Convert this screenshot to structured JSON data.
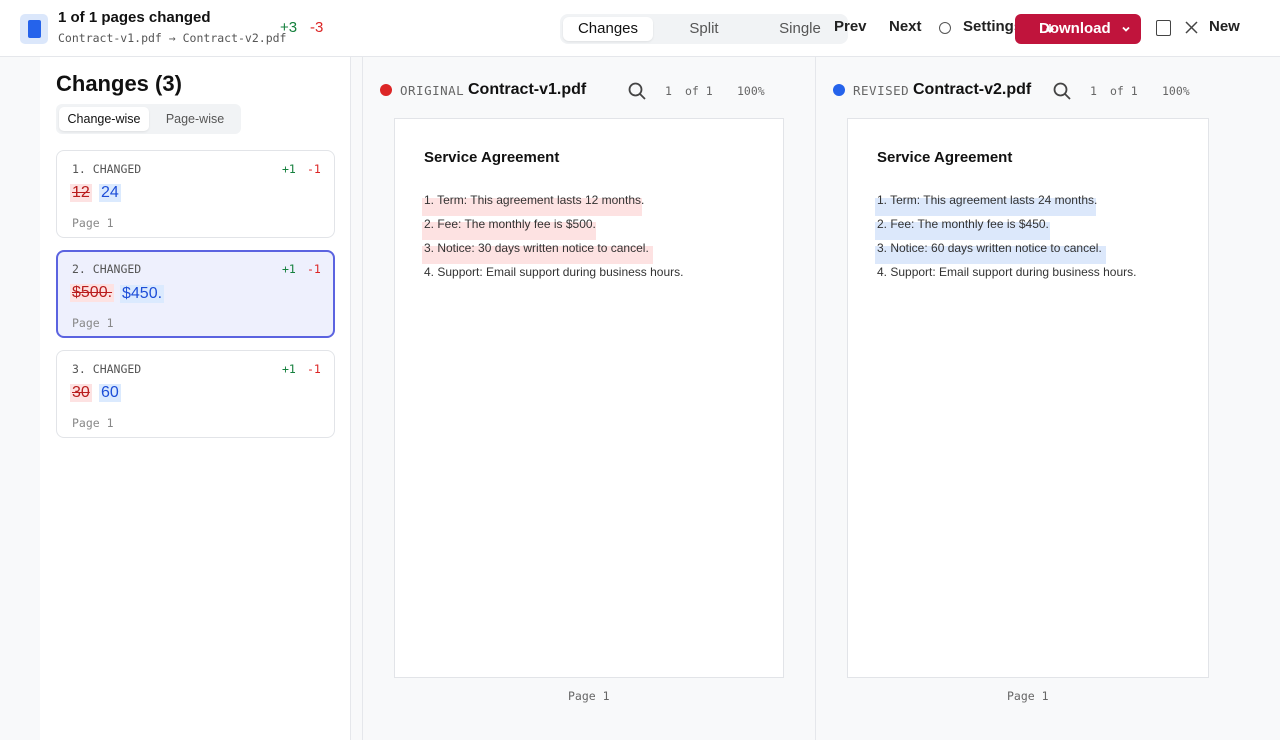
{
  "header": {
    "title": "1 of 1 pages changed",
    "files": "Contract-v1.pdf → Contract-v2.pdf",
    "added": "+3",
    "removed": "-3",
    "view_modes": [
      "Changes",
      "Split",
      "Single"
    ],
    "active_view": "Changes",
    "prev_label": "Prev",
    "next_label": "Next",
    "settings_label": "Settings",
    "download_label": "Download",
    "new_label": "New",
    "accent_color": "#c0143c"
  },
  "sidebar": {
    "title": "Changes (3)",
    "modes": [
      "Change-wise",
      "Page-wise"
    ],
    "active_mode": "Change-wise",
    "changes": [
      {
        "label": "1. CHANGED",
        "plus": "+1",
        "minus": "-1",
        "old": "12",
        "new": "24",
        "page": "Page 1",
        "active": false
      },
      {
        "label": "2. CHANGED",
        "plus": "+1",
        "minus": "-1",
        "old": "$500.",
        "new": "$450.",
        "page": "Page 1",
        "active": true
      },
      {
        "label": "3. CHANGED",
        "plus": "+1",
        "minus": "-1",
        "old": "30",
        "new": "60",
        "page": "Page 1",
        "active": false
      }
    ]
  },
  "viewers": {
    "original": {
      "tag": "ORIGINAL",
      "file": "Contract-v1.pdf",
      "page_num": "1",
      "page_of": "of 1",
      "zoom": "100%",
      "dot_color": "#dc2626",
      "doc_title": "Service Agreement",
      "lines": [
        "1. Term: This agreement lasts 12 months.",
        "2. Fee: The monthly fee is $500.",
        "3. Notice: 30 days written notice to cancel.",
        "4. Support: Email support during business hours."
      ],
      "footer": "Page 1"
    },
    "revised": {
      "tag": "REVISED",
      "file": "Contract-v2.pdf",
      "page_num": "1",
      "page_of": "of 1",
      "zoom": "100%",
      "dot_color": "#2563eb",
      "doc_title": "Service Agreement",
      "lines": [
        "1. Term: This agreement lasts 24 months.",
        "2. Fee: The monthly fee is $450.",
        "3. Notice: 60 days written notice to cancel.",
        "4. Support: Email support during business hours."
      ],
      "footer": "Page 1"
    }
  }
}
